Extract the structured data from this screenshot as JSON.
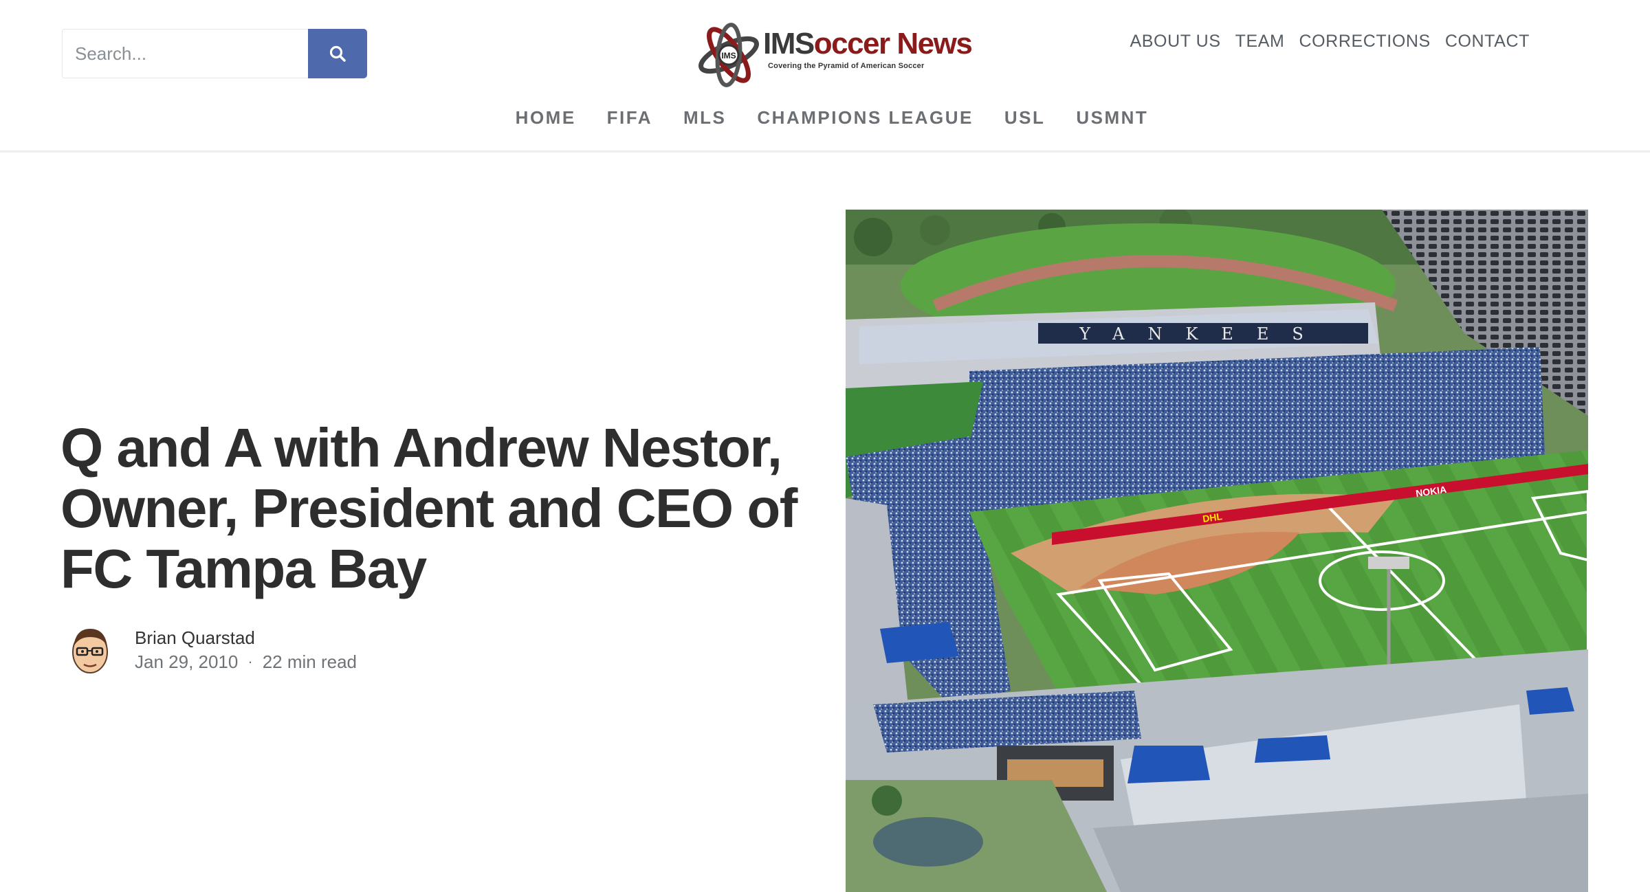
{
  "search": {
    "placeholder": "Search...",
    "icon": "search-icon"
  },
  "brand": {
    "name_prefix": "IMS",
    "name_suffix": "occer News",
    "tagline": "Covering the Pyramid of American Soccer",
    "badge": "IMS",
    "colors": {
      "dark": "#3a3a3a",
      "red": "#8b1a1a"
    }
  },
  "util_nav": [
    "ABOUT US",
    "TEAM",
    "CORRECTIONS",
    "CONTACT"
  ],
  "main_nav": [
    "HOME",
    "FIFA",
    "MLS",
    "CHAMPIONS LEAGUE",
    "USL",
    "USMNT"
  ],
  "article": {
    "title": "Q and A with Andrew Nestor, Owner, President and CEO of FC Tampa Bay",
    "author": "Brian Quarstad",
    "date": "Jan 29, 2010",
    "separator": "·",
    "read_time": "22 min read"
  },
  "hero_image": {
    "subject": "aerial-stadium-photo",
    "stadium_text": "YANKEES",
    "sponsor_text": [
      "DHL",
      "NOKIA"
    ]
  },
  "colors": {
    "accent": "#4e6aad",
    "text": "#2e2e2e",
    "muted": "#6e7378"
  }
}
